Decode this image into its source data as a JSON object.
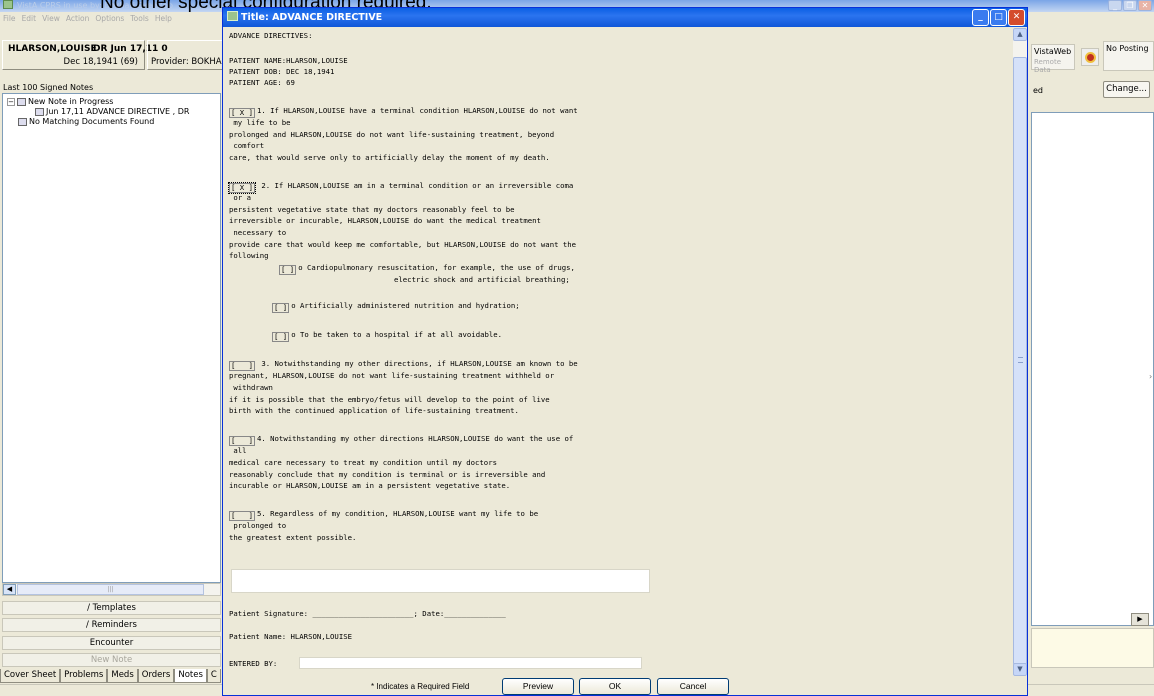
{
  "caption": "No other special configuration required.",
  "background_window": {
    "title": "VistA CPRS in use by: Bokhari,Syed (op",
    "menu": [
      "File",
      "Edit",
      "View",
      "Action",
      "Options",
      "Tools",
      "Help"
    ],
    "patient": {
      "name": "HLARSON,LOUISE",
      "dob_age": "Dec 18,1941 (69)",
      "dr_date": "DR Jun 17,11 0",
      "provider": "Provider: BOKHAR"
    },
    "notes_list_label": "Last 100 Signed Notes",
    "tree": {
      "new_note": "New Note in Progress",
      "note_item": "Jun 17,11  ADVANCE DIRECTIVE , DR",
      "no_matching": "No Matching Documents Found"
    },
    "side_buttons": {
      "templates": "/ Templates",
      "reminders": "/ Reminders",
      "encounter": "Encounter",
      "new_note": "New Note"
    },
    "tabs": [
      "Cover Sheet",
      "Problems",
      "Meds",
      "Orders",
      "Notes",
      "C"
    ],
    "active_tab": "Notes",
    "right": {
      "vistaweb": "VistaWeb",
      "remote_data": "Remote Data",
      "no_posting": "No Posting",
      "ed_label": "ed",
      "change_button": "Change..."
    }
  },
  "dialog": {
    "title": "Title: ADVANCE DIRECTIVE",
    "document": {
      "heading": "ADVANCE DIRECTIVES:",
      "patient_name_line": "PATIENT NAME:HLARSON,LOUISE",
      "patient_dob_line": "PATIENT DOB: DEC 18,1941",
      "patient_age_line": "PATIENT AGE: 69",
      "item1": {
        "box": "[ X ]",
        "lines": [
          "1. If HLARSON,LOUISE have a terminal condition HLARSON,LOUISE do not want",
          " my life to be",
          "prolonged and HLARSON,LOUISE do not want life-sustaining treatment, beyond",
          " comfort",
          "care, that would serve only to artificially delay the moment of my death."
        ]
      },
      "item2": {
        "box": "[ X ]",
        "lines": [
          " 2. If HLARSON,LOUISE am in a terminal condition or an irreversible coma",
          " or a",
          "persistent vegetative state that my doctors reasonably feel to be",
          "irreversible or incurable, HLARSON,LOUISE do want the medical treatment",
          " necessary to",
          "provide care that would keep me comfortable, but HLARSON,LOUISE do not want the",
          "following"
        ]
      },
      "sub_a": {
        "box": "[ ]",
        "lines": [
          "o Cardiopulmonary resuscitation, for example, the use of drugs,",
          "electric shock and artificial breathing;"
        ]
      },
      "sub_b": {
        "box": "[ ]",
        "line": "o Artificially administered nutrition and hydration;"
      },
      "sub_c": {
        "box": "[ ]",
        "line": "o To be taken to a hospital if at all avoidable."
      },
      "item3": {
        "box": "[   ]",
        "lines": [
          " 3. Notwithstanding my other directions, if HLARSON,LOUISE am known to be",
          "pregnant, HLARSON,LOUISE do not want life-sustaining treatment withheld or",
          " withdrawn",
          "if it is possible that the embryo/fetus will develop to the point of live",
          "birth with the continued application of life-sustaining treatment."
        ]
      },
      "item4": {
        "box": "[   ]",
        "lines": [
          "4. Notwithstanding my other directions HLARSON,LOUISE do want the use of",
          " all",
          "medical care necessary to treat my condition until my doctors",
          "reasonably conclude that my condition is terminal or is irreversible and",
          "incurable or HLARSON,LOUISE am in a persistent vegetative state."
        ]
      },
      "item5": {
        "box": "[   ]",
        "lines": [
          "5. Regardless of my condition, HLARSON,LOUISE want my life to be",
          " prolonged to",
          "the greatest extent possible."
        ]
      },
      "signature_line": "Patient Signature: _______________________; Date:______________",
      "patient_name_footer": "Patient Name: HLARSON,LOUISE",
      "entered_by_label": "ENTERED BY:"
    },
    "required_note": "* Indicates a Required Field",
    "buttons": {
      "preview": "Preview",
      "ok": "OK",
      "cancel": "Cancel"
    }
  },
  "colors": {
    "dialog_titlebar": "#0a5fe4",
    "window_face": "#ece9d8",
    "close_button": "#d44c2c"
  }
}
